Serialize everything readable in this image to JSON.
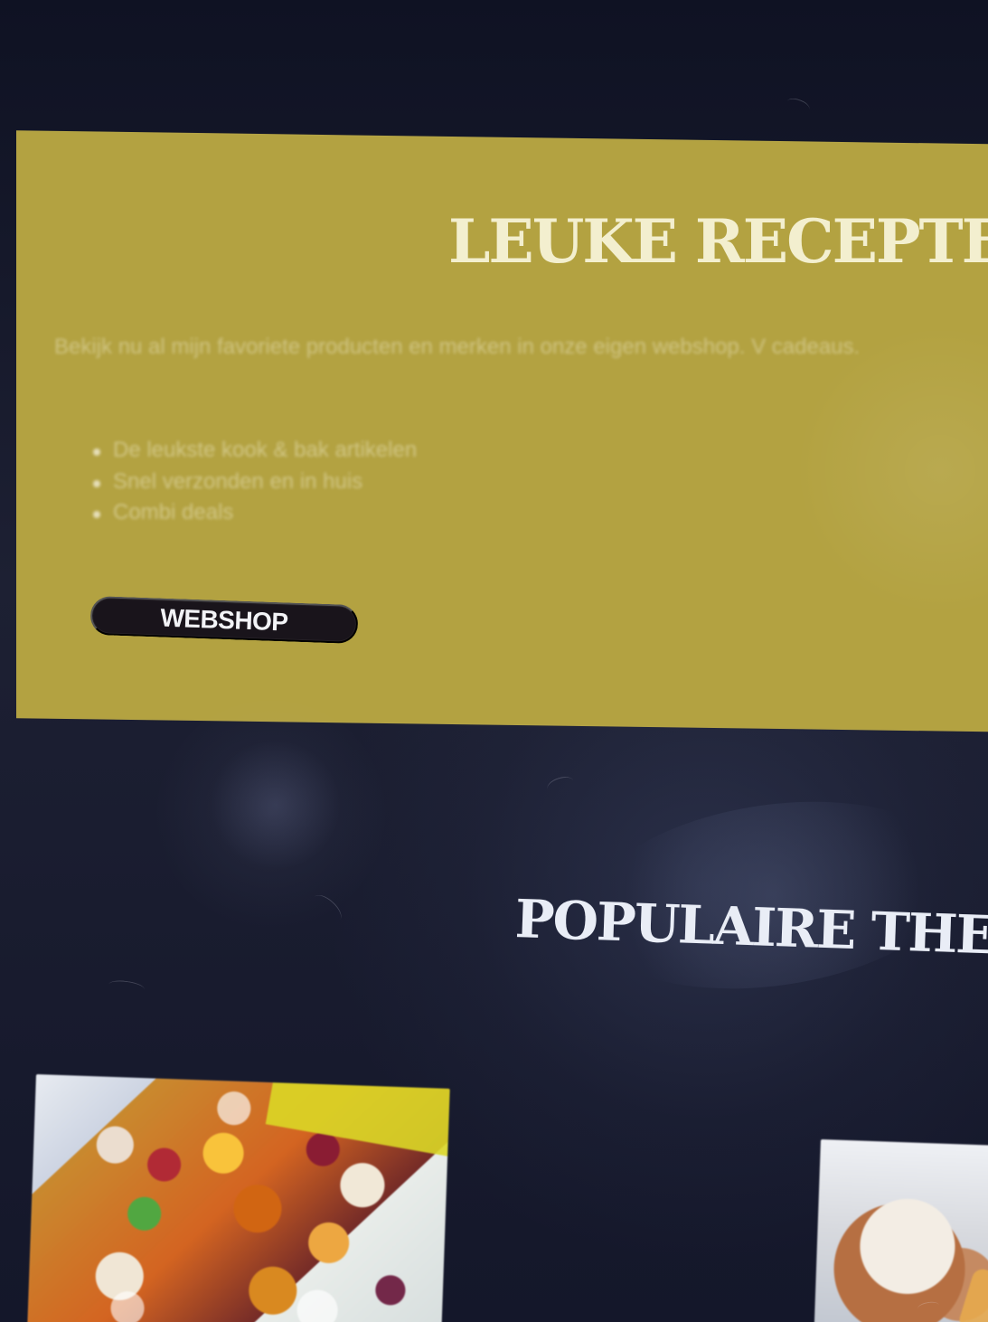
{
  "promo": {
    "title": "LEUKE RECEPTEN W",
    "description": "Bekijk nu al mijn favoriete producten en merken in onze eigen webshop. V cadeaus.",
    "items": [
      {
        "text": "De leukste kook & bak artikelen"
      },
      {
        "text": "Snel verzonden en in huis"
      },
      {
        "text": "Combi deals"
      }
    ],
    "button_label": "WEBSHOP",
    "background_color": "#b3a241",
    "button_color": "#19141b"
  },
  "section": {
    "title": "POPULAIRE THEM"
  },
  "cards": [
    {
      "icon": "food-image"
    },
    {
      "icon": "food-image"
    }
  ]
}
